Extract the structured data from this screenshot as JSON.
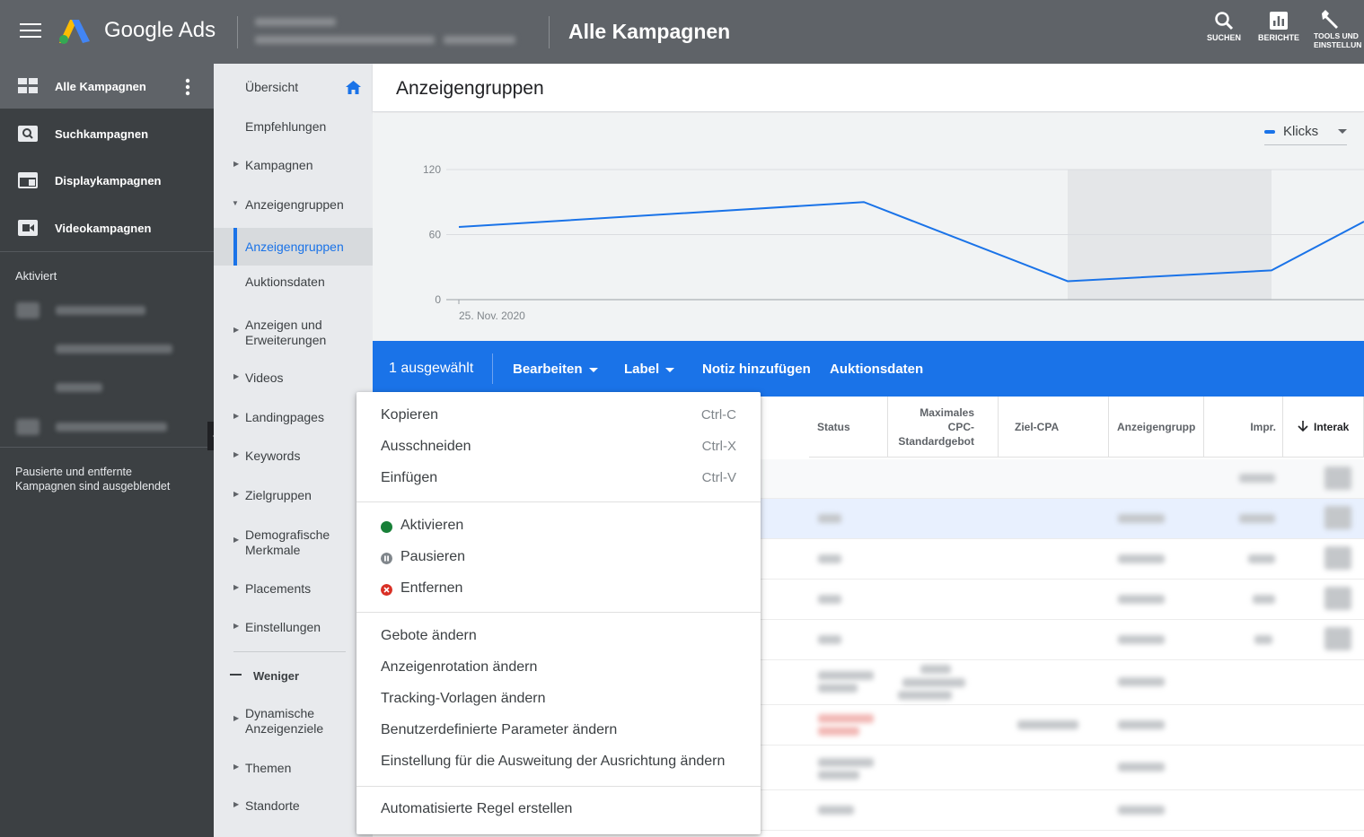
{
  "app": {
    "brand": "Google Ads",
    "page_title": "Alle Kampagnen"
  },
  "toolbar": {
    "search_label": "SUCHEN",
    "reports_label": "BERICHTE",
    "tools_label_1": "TOOLS UND",
    "tools_label_2": "EINSTELLUN"
  },
  "leftnav": {
    "items": [
      {
        "label": "Alle Kampagnen",
        "icon": "grid-icon"
      },
      {
        "label": "Suchkampagnen",
        "icon": "search-campaign-icon"
      },
      {
        "label": "Displaykampagnen",
        "icon": "display-campaign-icon"
      },
      {
        "label": "Videokampagnen",
        "icon": "video-campaign-icon"
      }
    ],
    "activated_label": "Aktiviert",
    "footer_note_1": "Pausierte und entfernte",
    "footer_note_2": "Kampagnen sind ausgeblendet"
  },
  "secnav": {
    "items": [
      {
        "label": "Übersicht"
      },
      {
        "label": "Empfehlungen"
      },
      {
        "label": "Kampagnen"
      },
      {
        "label": "Anzeigengruppen"
      },
      {
        "label": "Anzeigengruppen"
      },
      {
        "label": "Auktionsdaten"
      },
      {
        "label": "Anzeigen und",
        "label2": "Erweiterungen"
      },
      {
        "label": "Videos"
      },
      {
        "label": "Landingpages"
      },
      {
        "label": "Keywords"
      },
      {
        "label": "Zielgruppen"
      },
      {
        "label": "Demografische",
        "label2": "Merkmale"
      },
      {
        "label": "Placements"
      },
      {
        "label": "Einstellungen"
      },
      {
        "label": "Weniger"
      },
      {
        "label": "Dynamische",
        "label2": "Anzeigenziele"
      },
      {
        "label": "Themen"
      },
      {
        "label": "Standorte"
      }
    ]
  },
  "main": {
    "title": "Anzeigengruppen"
  },
  "chart_data": {
    "type": "line",
    "metric_selector": "Klicks",
    "color": "#1a73e8",
    "y_ticks": [
      "120",
      "60",
      "0"
    ],
    "ylim": [
      0,
      120
    ],
    "x_start_label": "25. Nov. 2020",
    "series": [
      {
        "values": [
          67,
          90,
          17,
          27,
          72
        ]
      }
    ],
    "grid": true
  },
  "actionbar": {
    "selected": "1 ausgewählt",
    "edit": "Bearbeiten",
    "label": "Label",
    "add_note": "Notiz hinzufügen",
    "auction": "Auktionsdaten"
  },
  "table": {
    "headers": {
      "status": "Status",
      "max_cpc_1": "Maximales",
      "max_cpc_2": "CPC-",
      "max_cpc_3": "Standardgebot",
      "target_cpa": "Ziel-CPA",
      "adgroup_type": "Anzeigengrupp",
      "impr": "Impr.",
      "interactions": "Interak"
    }
  },
  "dropdown": {
    "copy": "Kopieren",
    "copy_sc": "Ctrl-C",
    "cut": "Ausschneiden",
    "cut_sc": "Ctrl-X",
    "paste": "Einfügen",
    "paste_sc": "Ctrl-V",
    "enable": "Aktivieren",
    "pause": "Pausieren",
    "remove": "Entfernen",
    "change_bids": "Gebote ändern",
    "change_rotation": "Anzeigenrotation ändern",
    "change_tracking": "Tracking-Vorlagen ändern",
    "change_params": "Benutzerdefinierte Parameter ändern",
    "change_targeting": "Einstellung für die Ausweitung der Ausrichtung ändern",
    "auto_rule": "Automatisierte Regel erstellen",
    "colors": {
      "enable": "#188038",
      "pause": "#80868b",
      "remove": "#d93025"
    }
  }
}
